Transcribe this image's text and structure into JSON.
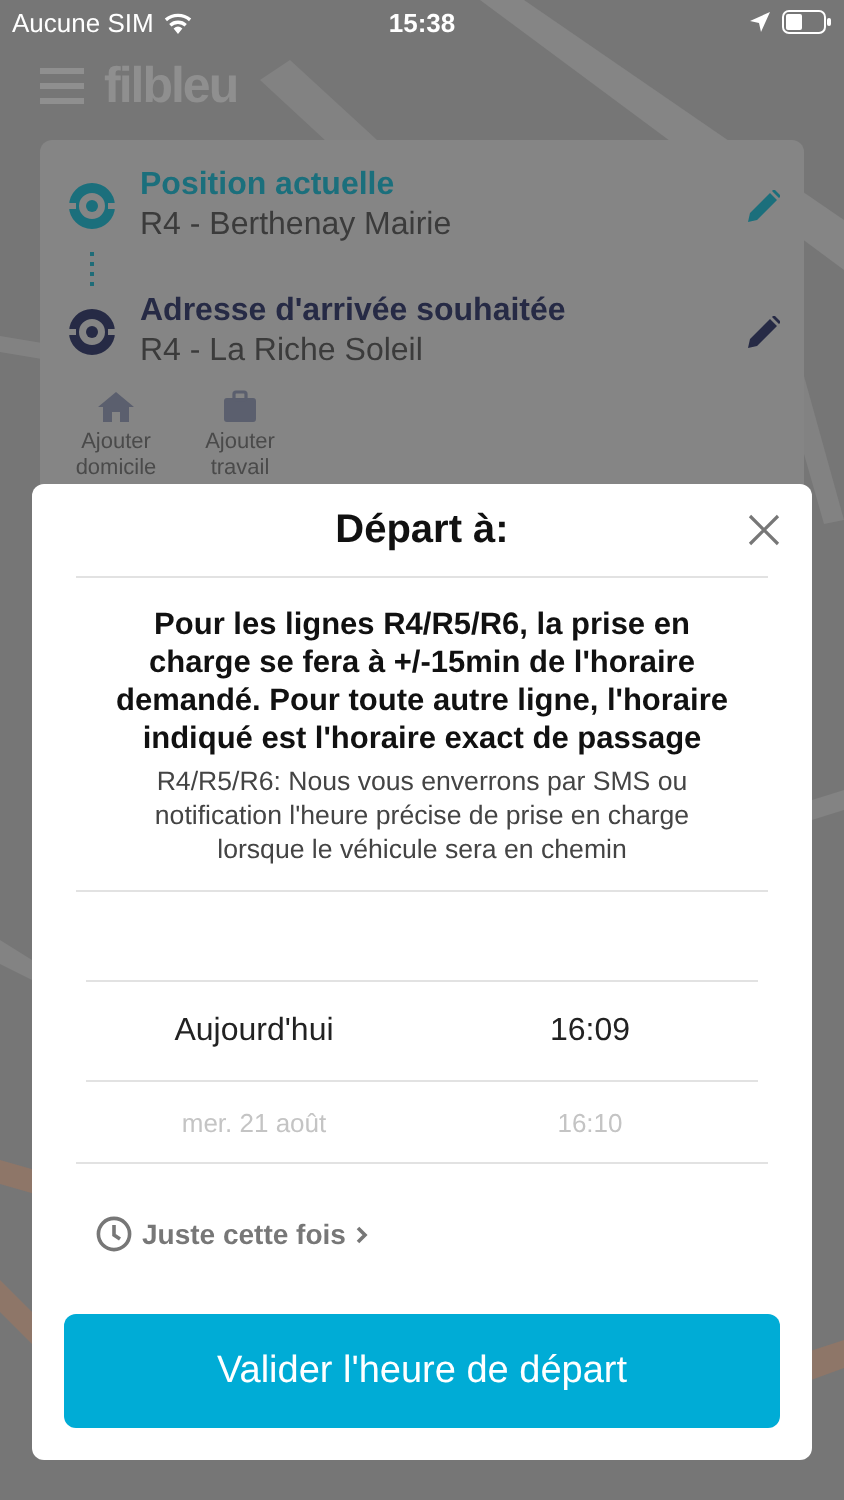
{
  "status_bar": {
    "carrier": "Aucune SIM",
    "time": "15:38"
  },
  "header": {
    "logo": "filbleu"
  },
  "trip": {
    "origin": {
      "title": "Position actuelle",
      "stop": "R4 - Berthenay Mairie"
    },
    "destination": {
      "title": "Adresse d'arrivée souhaitée",
      "stop": "R4 - La Riche Soleil"
    },
    "shortcuts": [
      {
        "kind": "home",
        "label": "Ajouter domicile"
      },
      {
        "kind": "work",
        "label": "Ajouter travail"
      }
    ]
  },
  "dialog": {
    "title": "Départ à:",
    "notice": "Pour les lignes R4/R5/R6, la prise en charge se fera à +/-15min de l'horaire demandé. Pour toute autre ligne, l'horaire indiqué est l'horaire exact de passage",
    "note": "R4/R5/R6: Nous vous enverrons par SMS ou notification l'heure précise de prise en charge lorsque le véhicule sera en chemin",
    "picker": [
      {
        "date": "Aujourd'hui",
        "time": "16:09",
        "selected": true
      },
      {
        "date": "mer. 21 août",
        "time": "16:10",
        "selected": false
      }
    ],
    "frequency": "Juste cette fois",
    "button": "Valider l'heure de départ"
  }
}
